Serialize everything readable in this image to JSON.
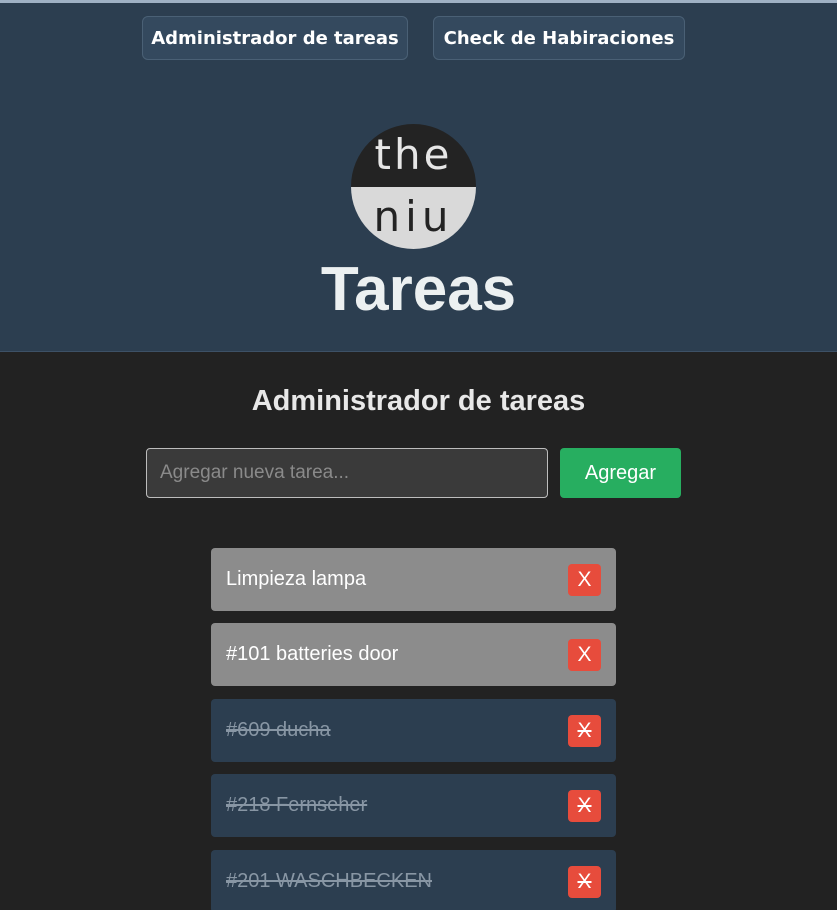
{
  "nav": {
    "tasks_button": "Administrador de tareas",
    "rooms_button": "Check de Habiraciones"
  },
  "logo": {
    "line1": "the",
    "line2": "niu"
  },
  "header": {
    "title": "Tareas"
  },
  "main": {
    "heading": "Administrador de tareas",
    "input_placeholder": "Agregar nueva tarea...",
    "input_value": "",
    "add_button": "Agregar"
  },
  "tasks": [
    {
      "label": "Limpieza lampa",
      "done": false,
      "delete_label": "X"
    },
    {
      "label": "#101 batteries door",
      "done": false,
      "delete_label": "X"
    },
    {
      "label": "#609 ducha",
      "done": true,
      "delete_label": "X"
    },
    {
      "label": "#218 Fernseher",
      "done": true,
      "delete_label": "X"
    },
    {
      "label": "#201 WASCHBECKEN",
      "done": true,
      "delete_label": "X"
    }
  ],
  "colors": {
    "header_bg": "#2c3e50",
    "body_bg": "#222222",
    "add_button": "#27ae60",
    "delete_button": "#e74c3c",
    "pending_task": "#8c8c8c",
    "done_task": "#2c3e50"
  }
}
